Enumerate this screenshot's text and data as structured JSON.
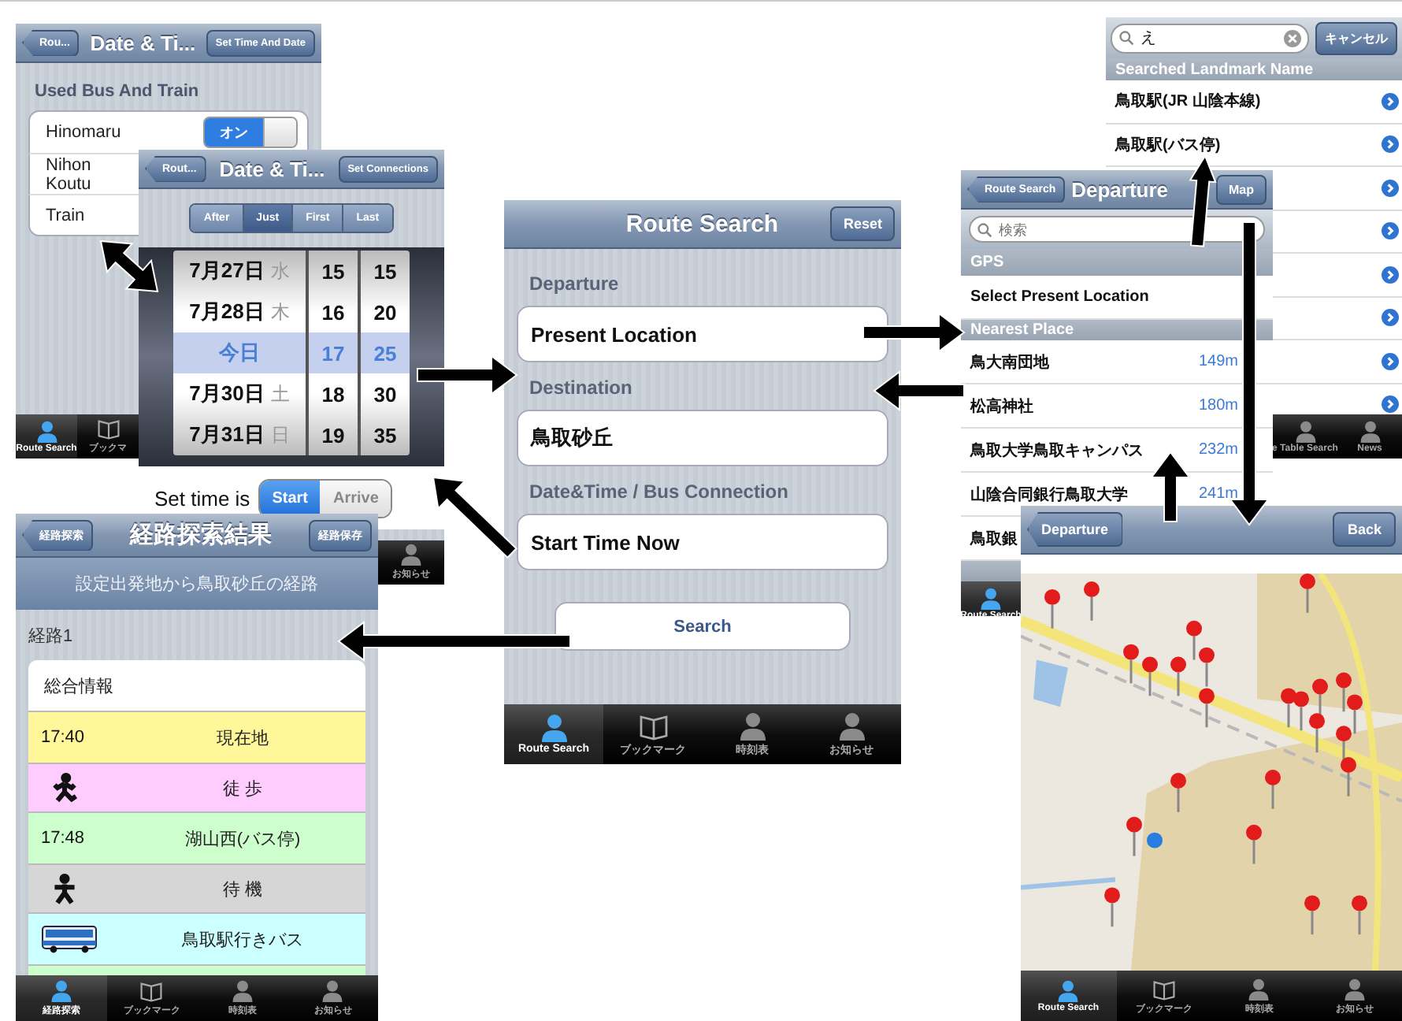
{
  "bus_settings_screen": {
    "back_button": "Rou...",
    "title": "Date & Ti...",
    "action_button": "Set Time And Date",
    "section": "Used Bus And Train",
    "rows": [
      {
        "label": "Hinomaru",
        "switch": {
          "label": "オン",
          "on": true
        }
      },
      {
        "label": "Nihon Koutu"
      },
      {
        "label": "Train"
      }
    ],
    "tabs": [
      {
        "label": "Route Search",
        "selected": true
      },
      {
        "label": "ブックマ",
        "selected": false
      }
    ]
  },
  "date_time_screen": {
    "back_button": "Rout...",
    "title": "Date & Ti...",
    "action_button": "Set Connections",
    "segments": [
      {
        "label": "After",
        "selected": false
      },
      {
        "label": "Just",
        "selected": true
      },
      {
        "label": "First",
        "selected": false
      },
      {
        "label": "Last",
        "selected": false
      }
    ],
    "picker_rows": [
      {
        "date": "7月27日",
        "weekday": "水",
        "hour": "15",
        "minute": "15",
        "selected": false
      },
      {
        "date": "7月28日",
        "weekday": "木",
        "hour": "16",
        "minute": "20",
        "selected": false
      },
      {
        "date": "今日",
        "hour": "17",
        "minute": "25",
        "selected": true
      },
      {
        "date": "7月30日",
        "weekday": "土",
        "hour": "18",
        "minute": "30",
        "selected": false
      },
      {
        "date": "7月31日",
        "weekday": "日",
        "hour": "19",
        "minute": "35",
        "selected": false
      }
    ],
    "set_time_label": "Set time is",
    "set_time_options": [
      {
        "label": "Start",
        "selected": true
      },
      {
        "label": "Arrive",
        "selected": false
      }
    ],
    "tabs": [
      {
        "label": "お知らせ",
        "selected": false
      }
    ]
  },
  "route_result_screen": {
    "back_button": "経路探索",
    "title": "経路探索結果",
    "action_button": "経路保存",
    "subtitle": "設定出発地から鳥取砂丘の経路",
    "section": "経路1",
    "rows": [
      {
        "kind": "header",
        "label": "総合情報",
        "color": "#ffffff"
      },
      {
        "kind": "stop",
        "time": "17:40",
        "label": "現在地",
        "color": "#fff799"
      },
      {
        "kind": "walk",
        "label": "徒 歩",
        "color": "#ffccff"
      },
      {
        "kind": "stop",
        "time": "17:48",
        "label": "湖山西(バス停)",
        "color": "#ccffcc"
      },
      {
        "kind": "wait",
        "label": "待 機",
        "color": "#d6d6d6"
      },
      {
        "kind": "bus",
        "label": "鳥取駅行きバス",
        "color": "#ccffff"
      },
      {
        "kind": "partial",
        "color": "#ccffcc"
      }
    ],
    "tabs": [
      {
        "label": "経路探索",
        "selected": true
      },
      {
        "label": "ブックマーク",
        "selected": false
      },
      {
        "label": "時刻表",
        "selected": false
      },
      {
        "label": "お知らせ",
        "selected": false
      }
    ]
  },
  "route_search_screen": {
    "title": "Route Search",
    "action_button": "Reset",
    "fields": [
      {
        "label": "Departure",
        "value": "Present Location"
      },
      {
        "label": "Destination",
        "value": "鳥取砂丘"
      },
      {
        "label": "Date&Time / Bus Connection",
        "value": "Start Time Now"
      }
    ],
    "search_button": "Search",
    "tabs": [
      {
        "label": "Route Search",
        "selected": true
      },
      {
        "label": "ブックマーク",
        "selected": false
      },
      {
        "label": "時刻表",
        "selected": false
      },
      {
        "label": "お知らせ",
        "selected": false
      }
    ]
  },
  "landmark_search_screen": {
    "search_value": "え",
    "cancel_button": "キャンセル",
    "section": "Searched Landmark Name",
    "rows": [
      {
        "label": "鳥取駅(JR 山陰本線)"
      },
      {
        "label": "鳥取駅(バス停)"
      },
      {},
      {},
      {},
      {},
      {},
      {}
    ],
    "tabs": [
      {
        "label": "e Table Search",
        "selected": false
      },
      {
        "label": "News",
        "selected": false
      }
    ]
  },
  "departure_screen": {
    "back_button": "Route Search",
    "title": "Departure",
    "action_button": "Map",
    "search_placeholder": "検索",
    "gps_section": "GPS",
    "gps_row": "Select Present Location",
    "nearest_section": "Nearest Place",
    "places": [
      {
        "name": "鳥大南団地",
        "distance": "149m"
      },
      {
        "name": "松高神社",
        "distance": "180m"
      },
      {
        "name": "鳥取大学鳥取キャンパス",
        "distance": "232m"
      },
      {
        "name": "山陰合同銀行鳥取大学",
        "distance": "241m"
      },
      {
        "name": "鳥取銀"
      }
    ],
    "tabs": [
      {
        "label": "Route Search",
        "selected": true
      }
    ]
  },
  "map_screen": {
    "back_button": "Departure",
    "action_button": "Back",
    "tabs": [
      {
        "label": "Route Search",
        "selected": true
      },
      {
        "label": "ブックマーク",
        "selected": false
      },
      {
        "label": "時刻表",
        "selected": false
      },
      {
        "label": "お知らせ",
        "selected": false
      }
    ]
  }
}
